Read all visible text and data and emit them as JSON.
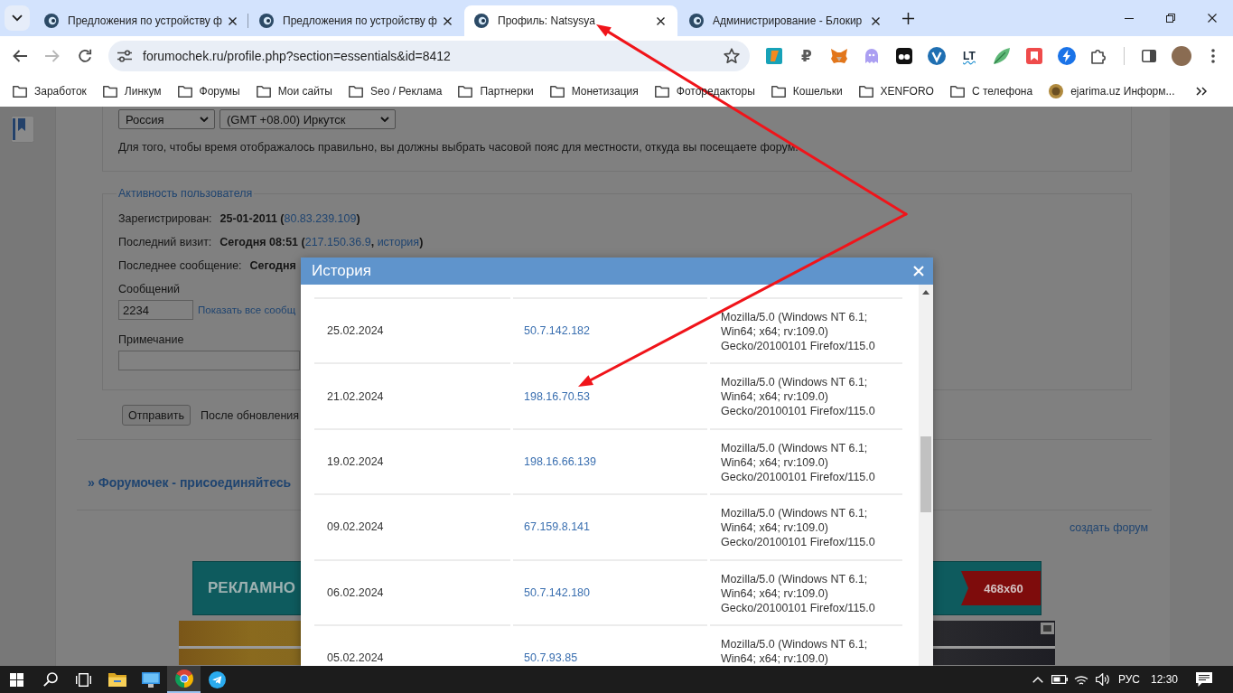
{
  "browser": {
    "tabs": [
      {
        "title": "Предложения по устройству ф",
        "selected": false
      },
      {
        "title": "Предложения по устройству ф",
        "selected": false
      },
      {
        "title": "Профиль: Natsysya",
        "selected": true
      },
      {
        "title": "Администрирование - Блокир",
        "selected": false
      }
    ],
    "forward_disabled": true,
    "address": "forumochek.ru/profile.php?section=essentials&id=8412",
    "extension_labels": [
      "₽",
      "LT"
    ],
    "bookmarks": [
      {
        "kind": "folder",
        "label": "Заработок"
      },
      {
        "kind": "folder",
        "label": "Линкум"
      },
      {
        "kind": "folder",
        "label": "Форумы"
      },
      {
        "kind": "folder",
        "label": "Мои сайты"
      },
      {
        "kind": "folder",
        "label": "Seo / Реклама"
      },
      {
        "kind": "folder",
        "label": "Партнерки"
      },
      {
        "kind": "folder",
        "label": "Монетизация"
      },
      {
        "kind": "folder",
        "label": "Фоторедакторы"
      },
      {
        "kind": "folder",
        "label": "Кошельки"
      },
      {
        "kind": "folder",
        "label": "XENFORO"
      },
      {
        "kind": "folder",
        "label": "С телефона"
      },
      {
        "kind": "site",
        "label": "ejarima.uz Информ..."
      }
    ]
  },
  "page": {
    "timezone": {
      "country": "Россия",
      "zone": "(GMT +08.00) Иркутск",
      "hint": "Для того, чтобы время отображалось правильно, вы должны выбрать часовой пояс для местности, откуда вы посещаете форум."
    },
    "activity": {
      "legend": "Активность пользователя",
      "rows": [
        {
          "label": "Зарегистрирован:",
          "parts": [
            {
              "kind": "text",
              "text": "25-01-2011 ("
            },
            {
              "kind": "link",
              "text": "80.83.239.109"
            },
            {
              "kind": "text",
              "text": ")"
            }
          ]
        },
        {
          "label": "Последний визит:",
          "parts": [
            {
              "kind": "text",
              "text": "Сегодня 08:51 ("
            },
            {
              "kind": "link",
              "text": "217.150.36.9"
            },
            {
              "kind": "text",
              "text": ", "
            },
            {
              "kind": "link",
              "text": "история"
            },
            {
              "kind": "text",
              "text": ")"
            }
          ]
        },
        {
          "label": "Последнее сообщение:",
          "parts": [
            {
              "kind": "text",
              "text": "Сегодня"
            }
          ]
        }
      ],
      "messages_label": "Сообщений",
      "messages_value": "2234",
      "messages_link": "Показать все сообщ",
      "note_label": "Примечание"
    },
    "submit_button": "Отправить",
    "submit_note": "После обновления",
    "forum_title": "» Форумочек - присоединяйтесь",
    "create_forum_link": "создать форум",
    "banner": {
      "text": "РЕКЛАМНО",
      "size": "468x60"
    }
  },
  "dialog": {
    "title": "История",
    "rows": [
      {
        "date": "25.02.2024",
        "ip": "50.7.142.182",
        "user_agent": "Mozilla/5.0 (Windows NT 6.1; Win64; x64; rv:109.0) Gecko/20100101 Firefox/115.0"
      },
      {
        "date": "21.02.2024",
        "ip": "198.16.70.53",
        "user_agent": "Mozilla/5.0 (Windows NT 6.1; Win64; x64; rv:109.0) Gecko/20100101 Firefox/115.0"
      },
      {
        "date": "19.02.2024",
        "ip": "198.16.66.139",
        "user_agent": "Mozilla/5.0 (Windows NT 6.1; Win64; x64; rv:109.0) Gecko/20100101 Firefox/115.0"
      },
      {
        "date": "09.02.2024",
        "ip": "67.159.8.141",
        "user_agent": "Mozilla/5.0 (Windows NT 6.1; Win64; x64; rv:109.0) Gecko/20100101 Firefox/115.0"
      },
      {
        "date": "06.02.2024",
        "ip": "50.7.142.180",
        "user_agent": "Mozilla/5.0 (Windows NT 6.1; Win64; x64; rv:109.0) Gecko/20100101 Firefox/115.0"
      },
      {
        "date": "05.02.2024",
        "ip": "50.7.93.85",
        "user_agent": "Mozilla/5.0 (Windows NT 6.1; Win64; x64; rv:109.0)"
      }
    ]
  },
  "taskbar": {
    "apps": [
      {
        "selected": false
      },
      {
        "selected": false
      },
      {
        "selected": true
      },
      {
        "selected": false
      }
    ],
    "language": "РУС",
    "time": "12:30"
  }
}
